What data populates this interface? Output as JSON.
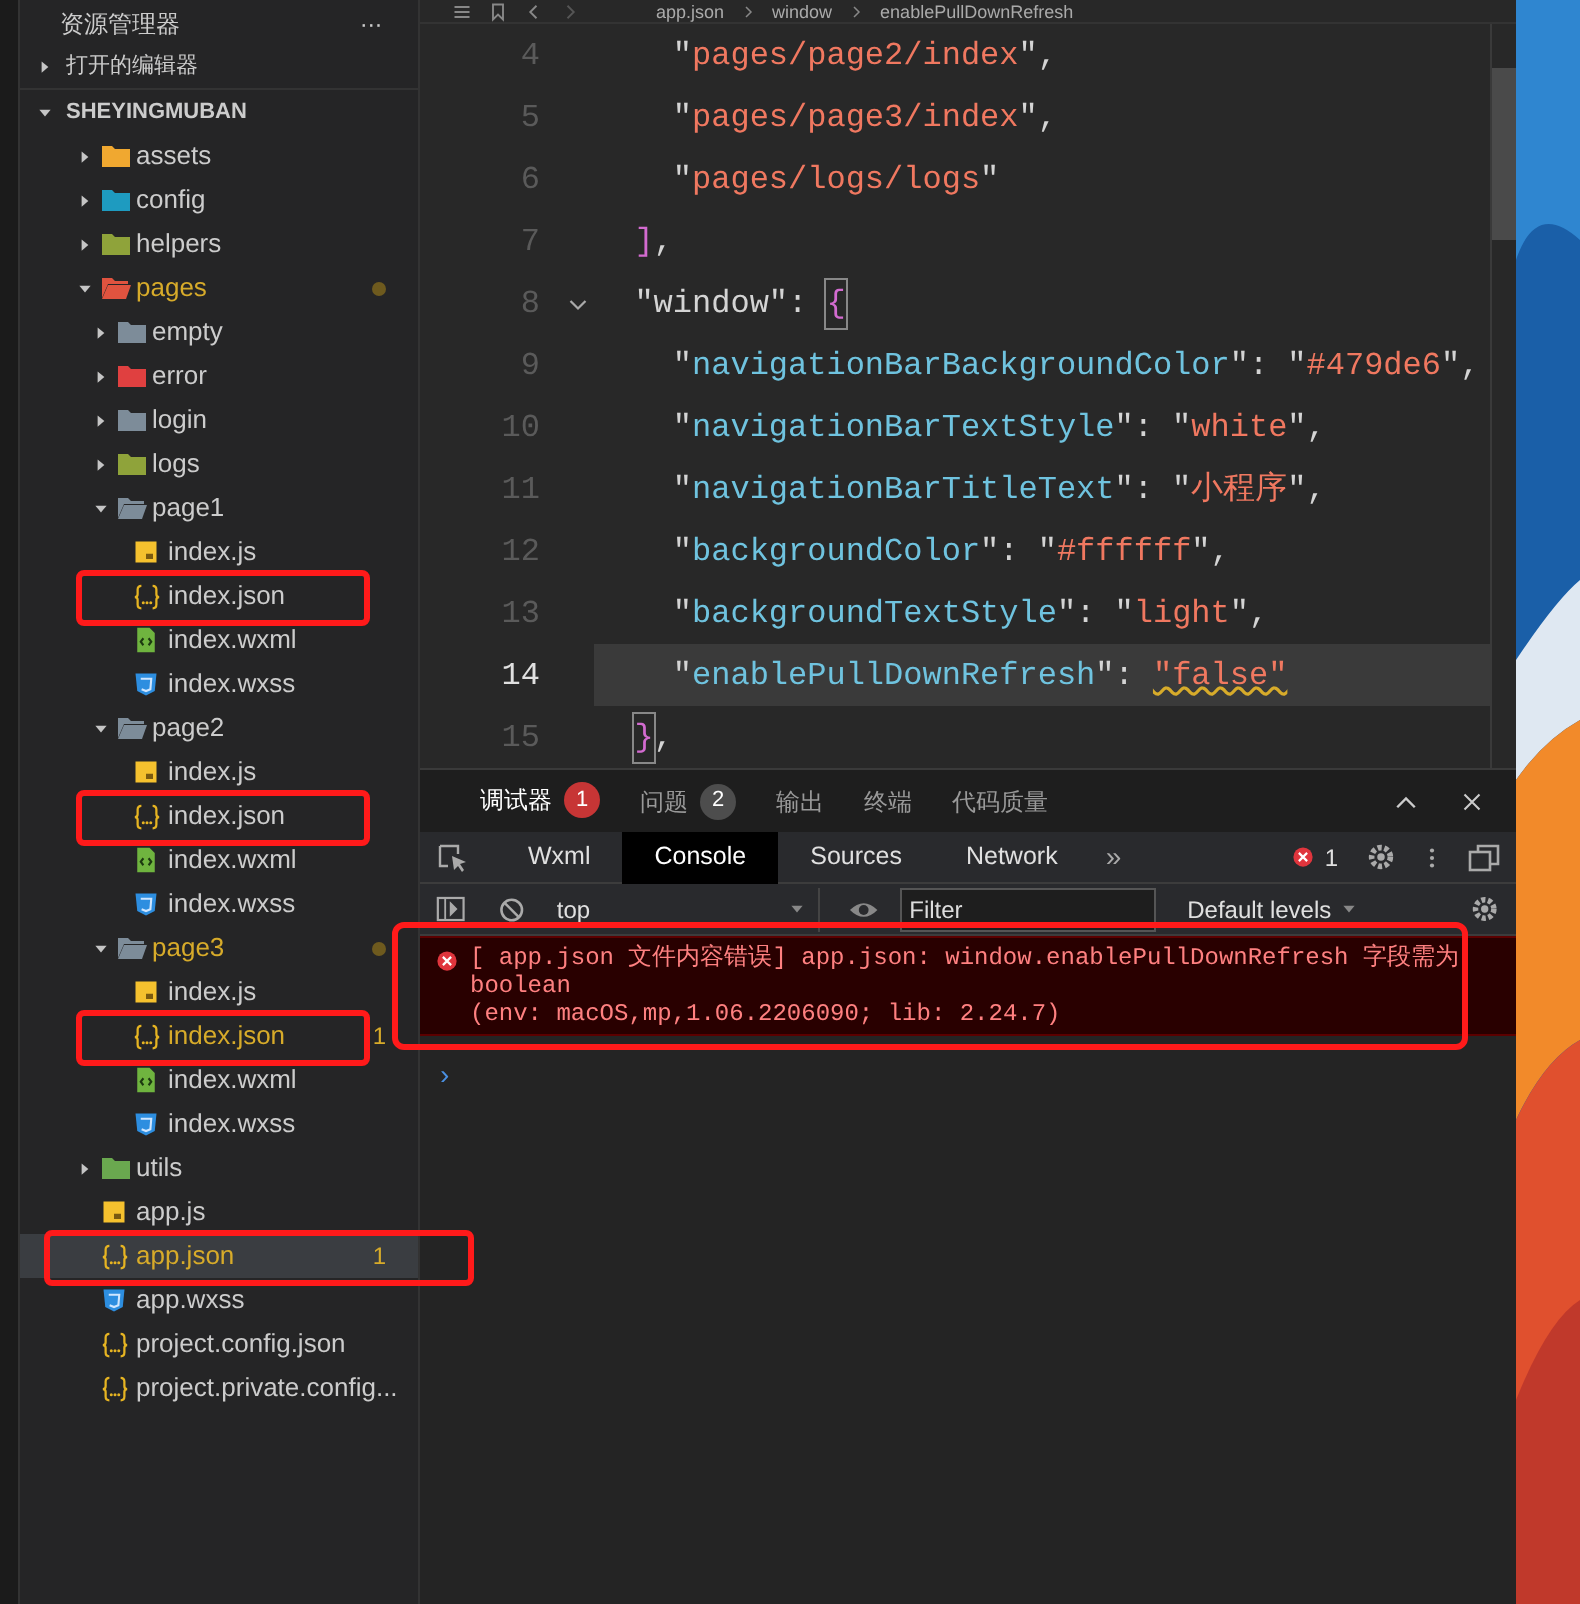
{
  "explorer": {
    "title": "资源管理器",
    "more": "···",
    "sections": [
      {
        "label": "打开的编辑器",
        "expanded": false
      }
    ],
    "project": {
      "name": "SHEYINGMUBAN",
      "expanded": true,
      "children": [
        {
          "name": "assets",
          "kind": "folder",
          "color": "#f0a830",
          "expanded": false,
          "selected": false
        },
        {
          "name": "config",
          "kind": "folder",
          "color": "#1e9bc0",
          "expanded": false,
          "selected": false
        },
        {
          "name": "helpers",
          "kind": "folder",
          "color": "#8fa33a",
          "expanded": false,
          "selected": false
        },
        {
          "name": "pages",
          "kind": "folder",
          "color": "#e0533f",
          "expanded": true,
          "modified": true,
          "dot": true,
          "selected": false,
          "children": [
            {
              "name": "empty",
              "kind": "folder",
              "color": "#7d8c99",
              "expanded": false,
              "selected": false
            },
            {
              "name": "error",
              "kind": "folder",
              "color": "#e04040",
              "expanded": false,
              "selected": false
            },
            {
              "name": "login",
              "kind": "folder",
              "color": "#7d8c99",
              "expanded": false,
              "selected": false
            },
            {
              "name": "logs",
              "kind": "folder",
              "color": "#8fa33a",
              "expanded": false,
              "selected": false
            },
            {
              "name": "page1",
              "kind": "folder",
              "color": "#7d8c99",
              "expanded": true,
              "selected": false,
              "children": [
                {
                  "name": "index.js",
                  "kind": "js",
                  "selected": false
                },
                {
                  "name": "index.json",
                  "kind": "json",
                  "selected": false,
                  "annotated": true
                },
                {
                  "name": "index.wxml",
                  "kind": "wxml",
                  "selected": false
                },
                {
                  "name": "index.wxss",
                  "kind": "wxss",
                  "selected": false
                }
              ]
            },
            {
              "name": "page2",
              "kind": "folder",
              "color": "#7d8c99",
              "expanded": true,
              "selected": false,
              "children": [
                {
                  "name": "index.js",
                  "kind": "js",
                  "selected": false
                },
                {
                  "name": "index.json",
                  "kind": "json",
                  "selected": false,
                  "annotated": true
                },
                {
                  "name": "index.wxml",
                  "kind": "wxml",
                  "selected": false
                },
                {
                  "name": "index.wxss",
                  "kind": "wxss",
                  "selected": false
                }
              ]
            },
            {
              "name": "page3",
              "kind": "folder",
              "color": "#7d8c99",
              "expanded": true,
              "modified": true,
              "dot": true,
              "selected": false,
              "children": [
                {
                  "name": "index.js",
                  "kind": "js",
                  "selected": false
                },
                {
                  "name": "index.json",
                  "kind": "json",
                  "modified": true,
                  "problems": "1",
                  "selected": false,
                  "annotated": true
                },
                {
                  "name": "index.wxml",
                  "kind": "wxml",
                  "selected": false
                },
                {
                  "name": "index.wxss",
                  "kind": "wxss",
                  "selected": false
                }
              ]
            }
          ]
        },
        {
          "name": "utils",
          "kind": "folder",
          "color": "#6aa84f",
          "expanded": false,
          "selected": false
        },
        {
          "name": "app.js",
          "kind": "js",
          "selected": false
        },
        {
          "name": "app.json",
          "kind": "json",
          "modified": true,
          "problems": "1",
          "selected": true,
          "annotated": true
        },
        {
          "name": "app.wxss",
          "kind": "wxss",
          "selected": false
        },
        {
          "name": "project.config.json",
          "kind": "json",
          "selected": false
        },
        {
          "name": "project.private.config...",
          "kind": "json",
          "selected": false
        }
      ]
    }
  },
  "breadcrumb": [
    "app.json",
    "window",
    "enablePullDownRefresh"
  ],
  "editor": {
    "lines": [
      {
        "number": "4",
        "current": false,
        "tokens": [
          {
            "kind": "punct",
            "text": "    \""
          },
          {
            "kind": "string",
            "text": "pages/page2/index"
          },
          {
            "kind": "punct",
            "text": "\","
          }
        ]
      },
      {
        "number": "5",
        "current": false,
        "tokens": [
          {
            "kind": "punct",
            "text": "    \""
          },
          {
            "kind": "string",
            "text": "pages/page3/index"
          },
          {
            "kind": "punct",
            "text": "\","
          }
        ]
      },
      {
        "number": "6",
        "current": false,
        "tokens": [
          {
            "kind": "punct",
            "text": "    \""
          },
          {
            "kind": "string",
            "text": "pages/logs/logs"
          },
          {
            "kind": "punct",
            "text": "\""
          }
        ]
      },
      {
        "number": "7",
        "current": false,
        "tokens": [
          {
            "kind": "bracket",
            "text": "  ]"
          },
          {
            "kind": "punct",
            "text": ","
          }
        ]
      },
      {
        "number": "8",
        "current": false,
        "foldable": true,
        "tokens": [
          {
            "kind": "punct",
            "text": "  \"window\": "
          },
          {
            "kind": "bracket",
            "text": "{",
            "matched": true
          }
        ]
      },
      {
        "number": "9",
        "current": false,
        "tokens": [
          {
            "kind": "punct",
            "text": "    \""
          },
          {
            "kind": "key",
            "text": "navigationBarBackgroundColor"
          },
          {
            "kind": "punct",
            "text": "\": \""
          },
          {
            "kind": "string",
            "text": "#479de6"
          },
          {
            "kind": "punct",
            "text": "\","
          }
        ]
      },
      {
        "number": "10",
        "current": false,
        "tokens": [
          {
            "kind": "punct",
            "text": "    \""
          },
          {
            "kind": "key",
            "text": "navigationBarTextStyle"
          },
          {
            "kind": "punct",
            "text": "\": \""
          },
          {
            "kind": "string",
            "text": "white"
          },
          {
            "kind": "punct",
            "text": "\","
          }
        ]
      },
      {
        "number": "11",
        "current": false,
        "tokens": [
          {
            "kind": "punct",
            "text": "    \""
          },
          {
            "kind": "key",
            "text": "navigationBarTitleText"
          },
          {
            "kind": "punct",
            "text": "\": \""
          },
          {
            "kind": "string",
            "text": "小程序"
          },
          {
            "kind": "punct",
            "text": "\","
          }
        ]
      },
      {
        "number": "12",
        "current": false,
        "tokens": [
          {
            "kind": "punct",
            "text": "    \""
          },
          {
            "kind": "key",
            "text": "backgroundColor"
          },
          {
            "kind": "punct",
            "text": "\": \""
          },
          {
            "kind": "string",
            "text": "#ffffff"
          },
          {
            "kind": "punct",
            "text": "\","
          }
        ]
      },
      {
        "number": "13",
        "current": false,
        "tokens": [
          {
            "kind": "punct",
            "text": "    \""
          },
          {
            "kind": "key",
            "text": "backgroundTextStyle"
          },
          {
            "kind": "punct",
            "text": "\": \""
          },
          {
            "kind": "string",
            "text": "light"
          },
          {
            "kind": "punct",
            "text": "\","
          }
        ]
      },
      {
        "number": "14",
        "current": true,
        "tokens": [
          {
            "kind": "punct",
            "text": "    \""
          },
          {
            "kind": "key",
            "text": "enablePullDownRefresh"
          },
          {
            "kind": "punct",
            "text": "\": "
          },
          {
            "kind": "string",
            "text": "\"false\"",
            "warning": true
          }
        ]
      },
      {
        "number": "15",
        "current": false,
        "tokens": [
          {
            "kind": "bracket",
            "text": "  }",
            "matched": true
          },
          {
            "kind": "punct",
            "text": ","
          }
        ]
      }
    ]
  },
  "panel": {
    "tabs": [
      {
        "label": "调试器",
        "badge": "1",
        "selected": true
      },
      {
        "label": "问题",
        "badge": "2",
        "selected": false
      },
      {
        "label": "输出",
        "selected": false
      },
      {
        "label": "终端",
        "selected": false
      },
      {
        "label": "代码质量",
        "selected": false
      }
    ],
    "devtools_tabs": [
      {
        "label": "Wxml",
        "selected": false
      },
      {
        "label": "Console",
        "selected": true
      },
      {
        "label": "Sources",
        "selected": false
      },
      {
        "label": "Network",
        "selected": false
      }
    ],
    "more_tabs": "»",
    "error_count": "1",
    "context": "top",
    "filter": {
      "placeholder": "Filter"
    },
    "levels": "Default levels",
    "messages": [
      {
        "kind": "error",
        "text": "[ app.json 文件内容错误] app.json: window.enablePullDownRefresh 字段需为 boolean",
        "detail": "(env: macOS,mp,1.06.2206090; lib: 2.24.7)",
        "annotated": true
      }
    ],
    "prompt": "›"
  }
}
